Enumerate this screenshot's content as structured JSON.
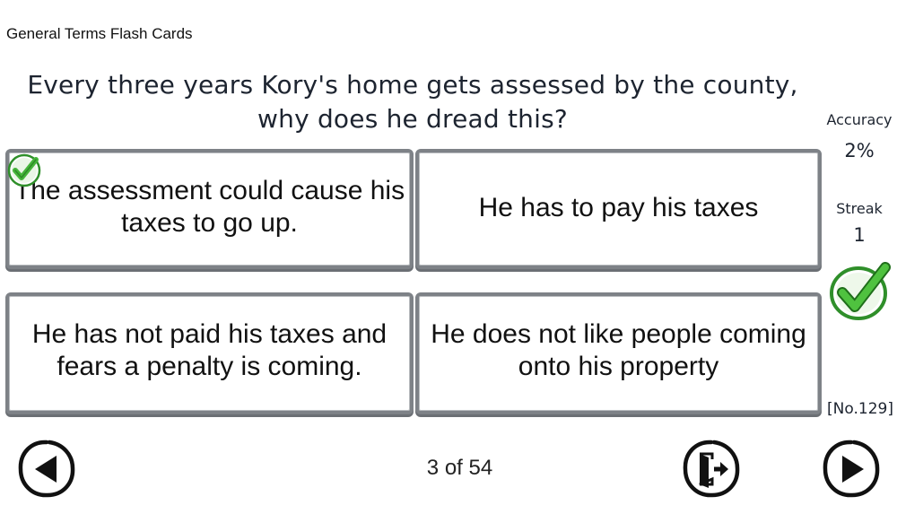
{
  "deck": {
    "title": "General Terms Flash Cards"
  },
  "question": {
    "text": "Every three years Kory's home gets assessed by the county, why does he dread this?"
  },
  "answers": [
    {
      "label": "The assessment could cause his taxes to go up.",
      "correct": true
    },
    {
      "label": "He has to pay his taxes",
      "correct": false
    },
    {
      "label": "He has not paid his taxes and fears a penalty is coming.",
      "correct": false
    },
    {
      "label": "He does not like people coming onto his property",
      "correct": false
    }
  ],
  "stats": {
    "accuracy_label": "Accuracy",
    "accuracy_value": "2%",
    "streak_label": "Streak",
    "streak_value": "1",
    "card_number": "[No.129]"
  },
  "navigation": {
    "progress": "3 of 54",
    "prev_icon": "left-arrow-icon",
    "exit_icon": "exit-door-icon",
    "next_icon": "right-arrow-icon"
  },
  "icons": {
    "correct_mark": "green-check-icon"
  },
  "colors": {
    "card_border": "#7e8287",
    "check_green": "#45b53a",
    "text_dark": "#1d2430"
  }
}
